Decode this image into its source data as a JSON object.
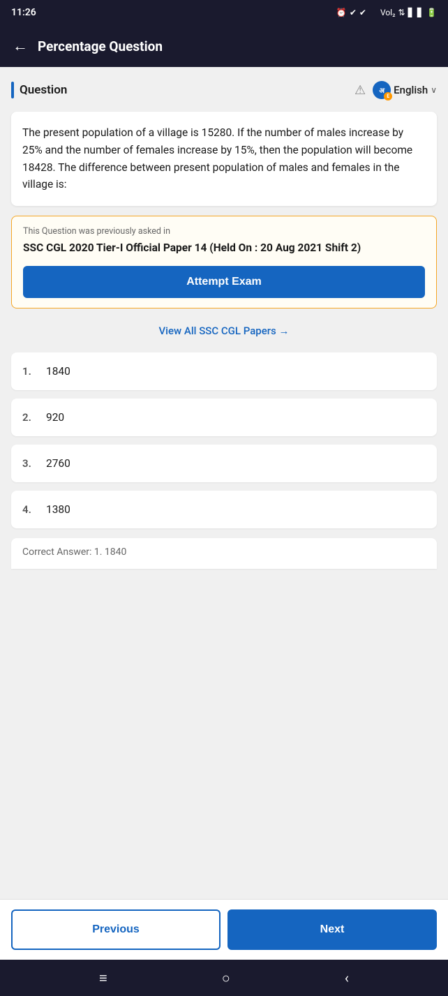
{
  "statusBar": {
    "time": "11:26",
    "icons": "⏰ VoLTE ⚡ WiFi ▪▪ 🔋"
  },
  "header": {
    "title": "Percentage Question",
    "backLabel": "←"
  },
  "questionSection": {
    "label": "Question",
    "warningIconTitle": "warning",
    "language": "English",
    "chevron": "∨"
  },
  "questionText": "The present population of a village is 15280. If the number of males increase by 25% and the number of females increase by 15%, then the population will become 18428. The difference between present population of males and females in the village is:",
  "previouslyAsked": {
    "label": "This Question was previously asked in",
    "title": "SSC CGL 2020 Tier-I Official Paper 14 (Held On : 20 Aug 2021 Shift 2)",
    "buttonLabel": "Attempt Exam"
  },
  "viewAllLink": "View All SSC CGL Papers  →",
  "options": [
    {
      "number": "1.",
      "value": "1840"
    },
    {
      "number": "2.",
      "value": "920"
    },
    {
      "number": "3.",
      "value": "2760"
    },
    {
      "number": "4.",
      "value": "1380"
    }
  ],
  "correctAnswer": "Correct Answer: 1. 1840",
  "navigation": {
    "previousLabel": "Previous",
    "nextLabel": "Next"
  },
  "bottomNav": {
    "menuIcon": "≡",
    "homeIcon": "○",
    "backIcon": "‹"
  }
}
